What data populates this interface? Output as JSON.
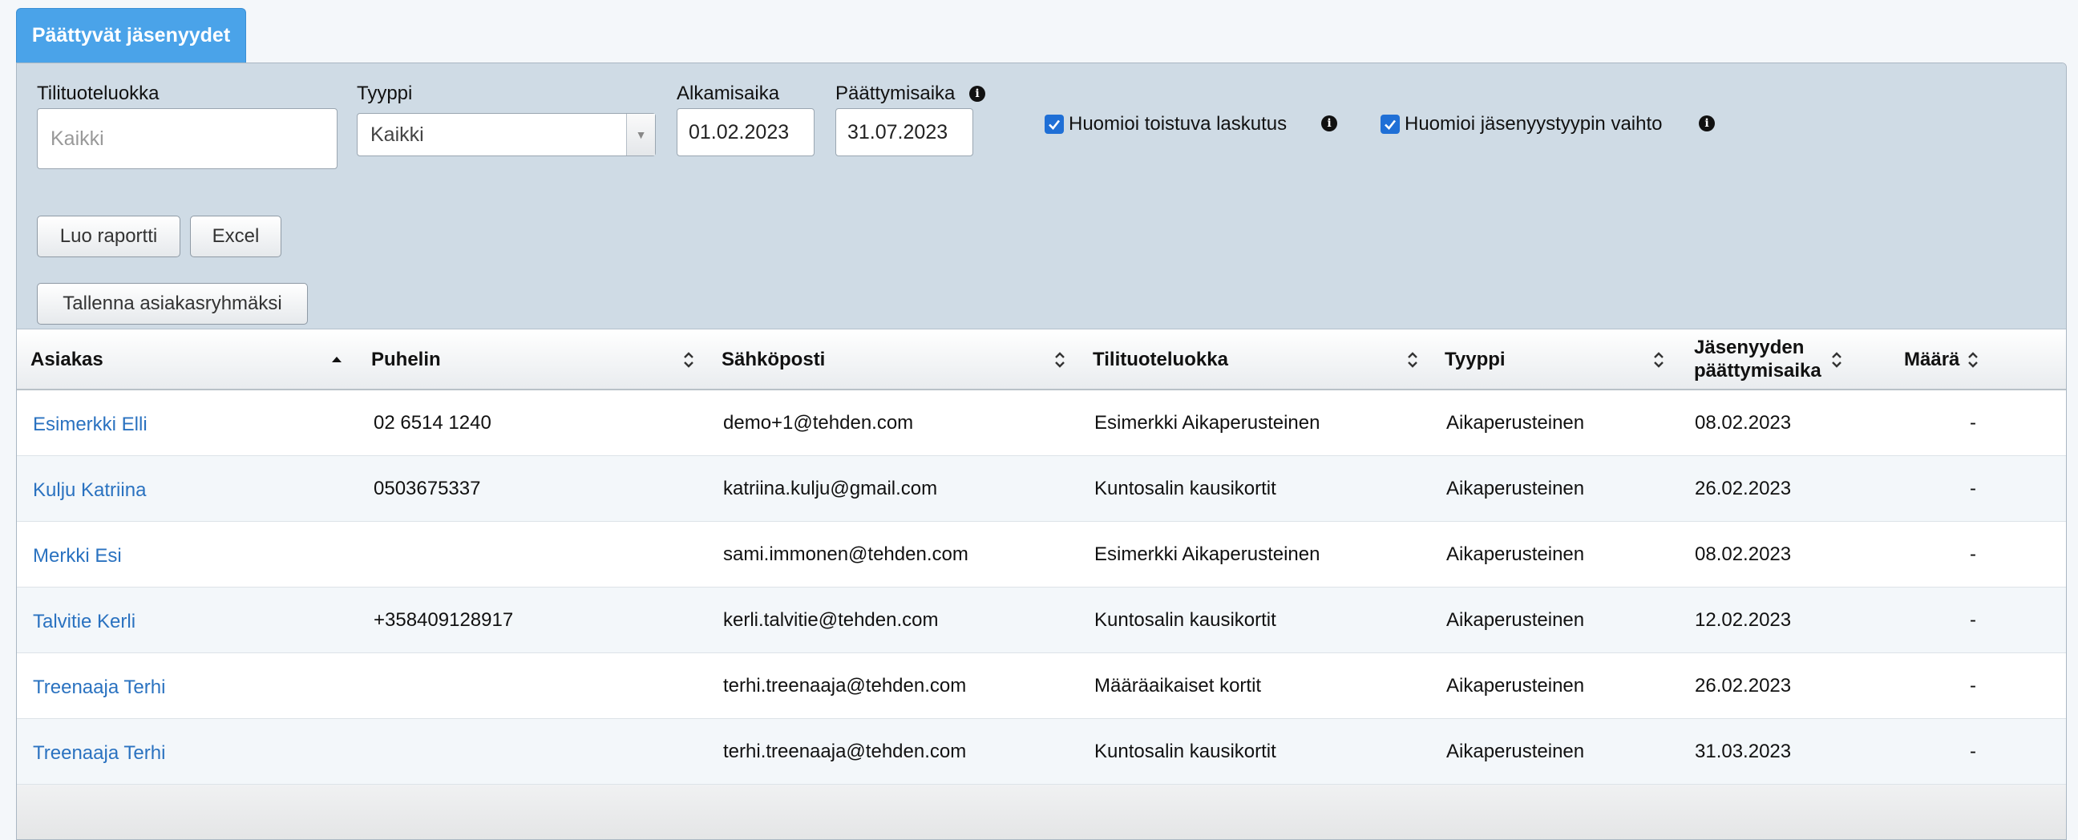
{
  "tab": {
    "label": "Päättyvät jäsenyydet"
  },
  "filters": {
    "tilituoteluokka": {
      "label": "Tilituoteluokka",
      "placeholder": "Kaikki"
    },
    "tyyppi": {
      "label": "Tyyppi",
      "value": "Kaikki"
    },
    "alkamisaika": {
      "label": "Alkamisaika",
      "value": "01.02.2023"
    },
    "paattymisaika": {
      "label": "Päättymisaika",
      "value": "31.07.2023"
    },
    "toistuva": {
      "label": "Huomioi toistuva laskutus",
      "checked": true
    },
    "vaihto": {
      "label": "Huomioi jäsenyystyypin vaihto",
      "checked": true
    }
  },
  "buttons": {
    "luo": "Luo raportti",
    "excel": "Excel",
    "tallenna": "Tallenna asiakasryhmäksi"
  },
  "table": {
    "headers": {
      "asiakas": "Asiakas",
      "puhelin": "Puhelin",
      "sahkoposti": "Sähköposti",
      "tilituoteluokka": "Tilituoteluokka",
      "tyyppi": "Tyyppi",
      "paattymisaika_1": "Jäsenyyden",
      "paattymisaika_2": "päättymisaika",
      "maara": "Määrä"
    },
    "rows": [
      {
        "asiakas": "Esimerkki Elli",
        "puhelin": "02 6514 1240",
        "sahkoposti": "demo+1@tehden.com",
        "tilituoteluokka": "Esimerkki Aikaperusteinen",
        "tyyppi": "Aikaperusteinen",
        "paattymisaika": "08.02.2023",
        "maara": "-"
      },
      {
        "asiakas": "Kulju Katriina",
        "puhelin": "0503675337",
        "sahkoposti": "katriina.kulju@gmail.com",
        "tilituoteluokka": "Kuntosalin kausikortit",
        "tyyppi": "Aikaperusteinen",
        "paattymisaika": "26.02.2023",
        "maara": "-"
      },
      {
        "asiakas": "Merkki Esi",
        "puhelin": "",
        "sahkoposti": "sami.immonen@tehden.com",
        "tilituoteluokka": "Esimerkki Aikaperusteinen",
        "tyyppi": "Aikaperusteinen",
        "paattymisaika": "08.02.2023",
        "maara": "-"
      },
      {
        "asiakas": "Talvitie Kerli",
        "puhelin": "+358409128917",
        "sahkoposti": "kerli.talvitie@tehden.com",
        "tilituoteluokka": "Kuntosalin kausikortit",
        "tyyppi": "Aikaperusteinen",
        "paattymisaika": "12.02.2023",
        "maara": "-"
      },
      {
        "asiakas": "Treenaaja Terhi",
        "puhelin": "",
        "sahkoposti": "terhi.treenaaja@tehden.com",
        "tilituoteluokka": "Määräaikaiset kortit",
        "tyyppi": "Aikaperusteinen",
        "paattymisaika": "26.02.2023",
        "maara": "-"
      },
      {
        "asiakas": "Treenaaja Terhi",
        "puhelin": "",
        "sahkoposti": "terhi.treenaaja@tehden.com",
        "tilituoteluokka": "Kuntosalin kausikortit",
        "tyyppi": "Aikaperusteinen",
        "paattymisaika": "31.03.2023",
        "maara": "-"
      }
    ]
  }
}
